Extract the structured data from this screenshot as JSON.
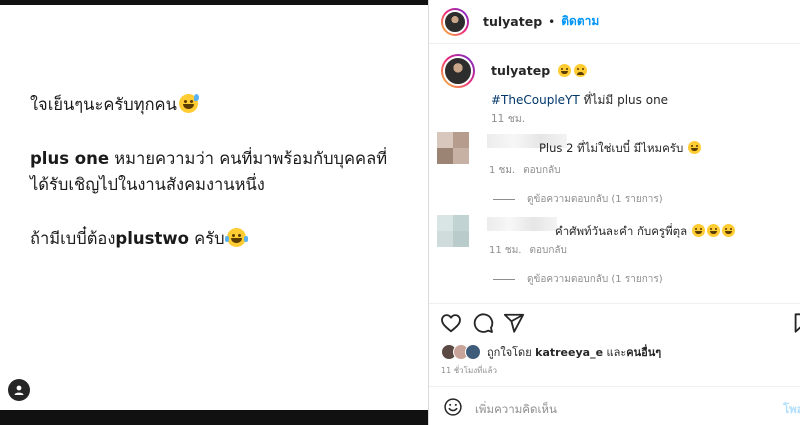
{
  "post": {
    "line1": "ใจเย็นๆนะครับทุกคน",
    "line2_bold": "plus one",
    "line2_rest": " หมายความว่า คนที่มาพร้อมกับบุคคลที่",
    "line3": "ได้รับเชิญไปในงานสังคมงานหนึ่ง",
    "line4_pre": "ถ้ามีเบบี๋ต้อง",
    "line4_bold": "plustwo",
    "line4_post": " ครับ"
  },
  "header": {
    "username": "tulyatep",
    "separator": "•",
    "follow_label": "ติดตาม"
  },
  "caption": {
    "username": "tulyatep",
    "hashtag": "#TheCoupleYT",
    "text": " ที่ไม่มี plus one",
    "time": "11 ชม."
  },
  "comments": [
    {
      "text": "Plus 2 ที่ไม่ใช่เบบี๋ มีไหมครับ",
      "time": "1 ชม.",
      "reply_label": "ตอบกลับ",
      "replies_label": "ดูข้อความตอบกลับ (1 รายการ)"
    },
    {
      "text": "คำศัพท์วันละคำ กับครูพี่ตุล",
      "time": "11 ชม.",
      "reply_label": "ตอบกลับ",
      "replies_label": "ดูข้อความตอบกลับ (1 รายการ)"
    }
  ],
  "likes": {
    "prefix": "ถูกใจโดย ",
    "user": "katreeya_e",
    "middle": " และ",
    "others": "คนอื่นๆ"
  },
  "posted_ago": "11 ชั่วโมงที่แล้ว",
  "add_comment": {
    "placeholder": "เพิ่มความคิดเห็น",
    "post_label": "โพส"
  },
  "icons": [
    "emoji-sweat-smile-icon",
    "emoji-tears-joy-icon",
    "user-tag-icon",
    "heart-icon",
    "comment-icon",
    "share-icon",
    "bookmark-icon",
    "smiley-icon"
  ],
  "colors": {
    "follow": "#0095f6",
    "story_ring": "#ee2a7b",
    "post_disabled": "#b2dffc"
  }
}
